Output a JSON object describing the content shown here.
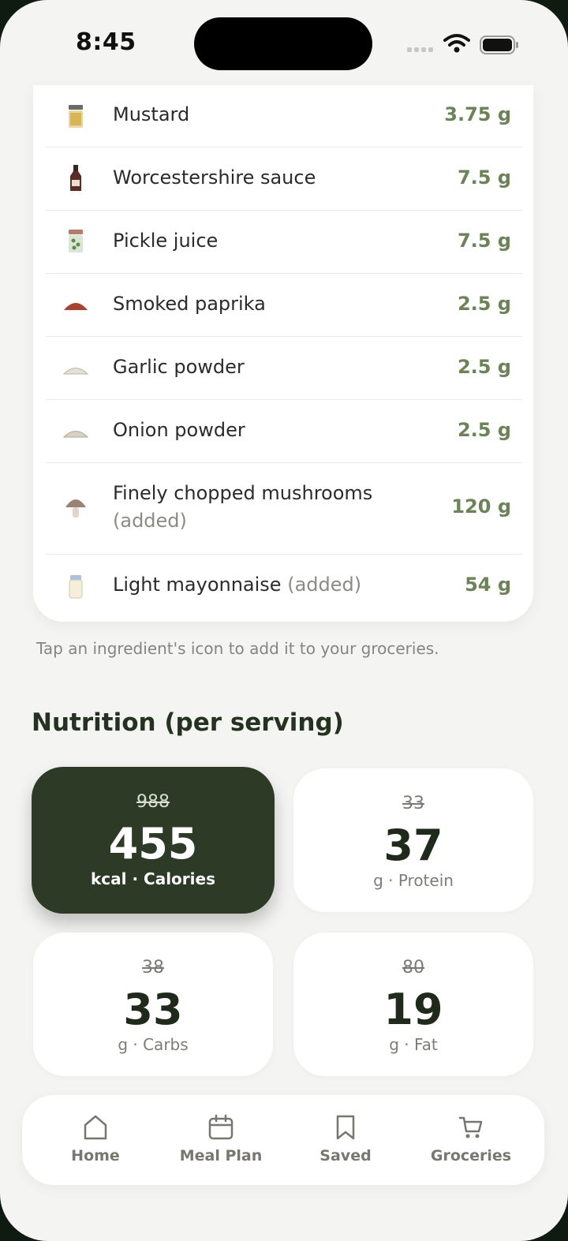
{
  "status": {
    "time": "8:45"
  },
  "ingredients": [
    {
      "name": "Mustard",
      "added": "",
      "qty": "3.75 g",
      "icon": "mustard-jar-icon"
    },
    {
      "name": "Worcestershire sauce",
      "added": "",
      "qty": "7.5 g",
      "icon": "sauce-bottle-icon"
    },
    {
      "name": "Pickle juice",
      "added": "",
      "qty": "7.5 g",
      "icon": "pickle-jar-icon"
    },
    {
      "name": "Smoked paprika",
      "added": "",
      "qty": "2.5 g",
      "icon": "paprika-pile-icon"
    },
    {
      "name": "Garlic powder",
      "added": "",
      "qty": "2.5 g",
      "icon": "powder-pile-icon"
    },
    {
      "name": "Onion powder",
      "added": "",
      "qty": "2.5 g",
      "icon": "powder-pile-icon"
    },
    {
      "name": "Finely chopped mushrooms",
      "added": "(added)",
      "qty": "120 g",
      "icon": "mushroom-icon"
    },
    {
      "name": "Light mayonnaise",
      "added": "(added)",
      "qty": "54 g",
      "icon": "mayonnaise-jar-icon"
    }
  ],
  "hint": "Tap an ingredient's icon to add it to your groceries.",
  "nutrition": {
    "title": "Nutrition (per serving)",
    "cards": [
      {
        "old": "988",
        "value": "455",
        "unit": "kcal · Calories"
      },
      {
        "old": "33",
        "value": "37",
        "unit": "g · Protein"
      },
      {
        "old": "38",
        "value": "33",
        "unit": "g · Carbs"
      },
      {
        "old": "80",
        "value": "19",
        "unit": "g · Fat"
      }
    ]
  },
  "tabs": [
    {
      "label": "Home",
      "icon": "home-icon"
    },
    {
      "label": "Meal Plan",
      "icon": "calendar-icon"
    },
    {
      "label": "Saved",
      "icon": "bookmark-icon"
    },
    {
      "label": "Groceries",
      "icon": "cart-icon"
    }
  ],
  "colors": {
    "accent": "#6a8456",
    "dark_card": "#2c3a26",
    "background": "#f4f4f2"
  }
}
